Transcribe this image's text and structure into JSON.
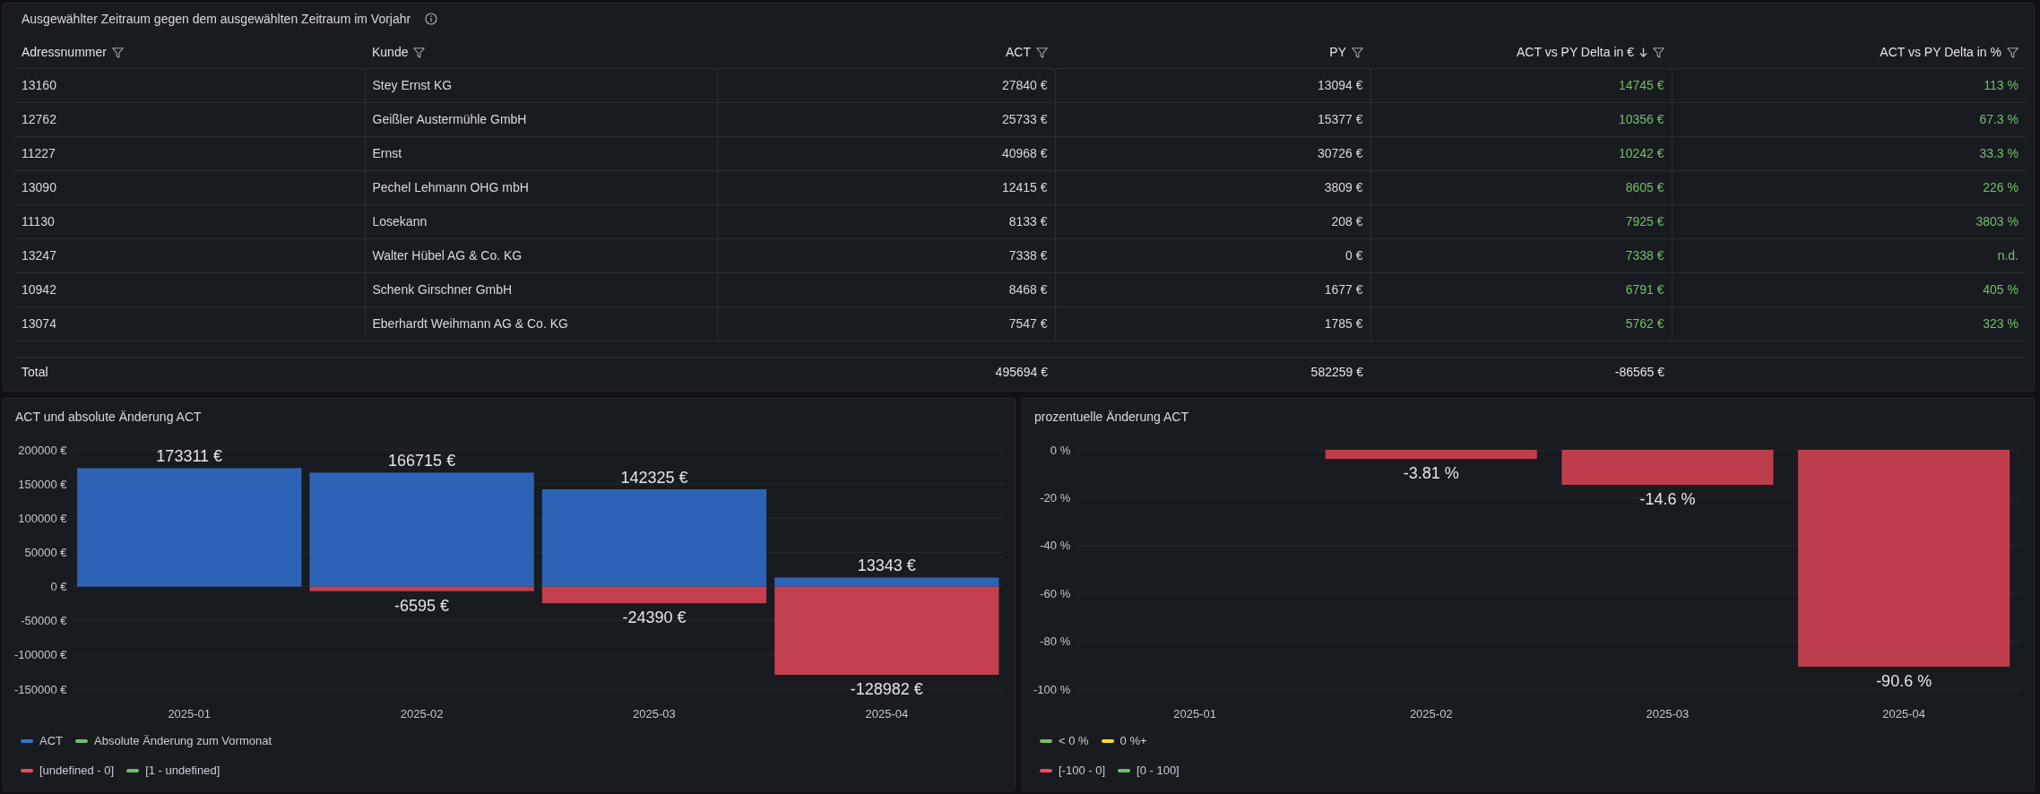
{
  "table_panel": {
    "title": "Ausgewählter Zeitraum gegen dem ausgewählten Zeitraum im Vorjahr",
    "columns": [
      {
        "label": "Adressnummer",
        "kind": "text",
        "sorted": false
      },
      {
        "label": "Kunde",
        "kind": "text",
        "sorted": false
      },
      {
        "label": "ACT",
        "kind": "number",
        "sorted": false
      },
      {
        "label": "PY",
        "kind": "number",
        "sorted": false
      },
      {
        "label": "ACT vs PY Delta in €",
        "kind": "delta",
        "sorted": true
      },
      {
        "label": "ACT vs PY Delta in %",
        "kind": "delta",
        "sorted": false
      }
    ],
    "rows": [
      {
        "cells": [
          "13160",
          "Stey Ernst KG",
          "27840 €",
          "13094 €",
          "14745 €",
          "113 %"
        ]
      },
      {
        "cells": [
          "12762",
          "Geißler Austermühle GmbH",
          "25733 €",
          "15377 €",
          "10356 €",
          "67.3 %"
        ]
      },
      {
        "cells": [
          "11227",
          "Ernst",
          "40968 €",
          "30726 €",
          "10242 €",
          "33.3 %"
        ]
      },
      {
        "cells": [
          "13090",
          "Pechel Lehmann OHG mbH",
          "12415 €",
          "3809 €",
          "8605 €",
          "226 %"
        ]
      },
      {
        "cells": [
          "11130",
          "Losekann",
          "8133 €",
          "208 €",
          "7925 €",
          "3803 %"
        ]
      },
      {
        "cells": [
          "13247",
          "Walter Hübel AG & Co. KG",
          "7338 €",
          "0 €",
          "7338 €",
          "n.d."
        ]
      },
      {
        "cells": [
          "10942",
          "Schenk Girschner GmbH",
          "8468 €",
          "1677 €",
          "6791 €",
          "405 %"
        ]
      },
      {
        "cells": [
          "13074",
          "Eberhardt Weihmann AG & Co. KG",
          "7547 €",
          "1785 €",
          "5762 €",
          "323 %"
        ]
      }
    ],
    "total": {
      "label": "Total",
      "act": "495694 €",
      "py": "582259 €",
      "delta": "-86565 €"
    }
  },
  "chart_panels": [
    {
      "title": "ACT und absolute Änderung ACT",
      "chart_data": {
        "type": "bar",
        "categories": [
          "2025-01",
          "2025-02",
          "2025-03",
          "2025-04"
        ],
        "series": [
          {
            "color": "#2d63b6",
            "values": [
              173311,
              166715,
              142325,
              13343
            ]
          },
          {
            "color": "#c4404f",
            "values": [
              null,
              -6595,
              -24390,
              -128982
            ]
          }
        ],
        "stacked": true,
        "grid": true,
        "ylim": [
          -150000,
          200000
        ],
        "yticks": [
          {
            "value": 200000,
            "label": "200000 €"
          },
          {
            "value": 150000,
            "label": "150000 €"
          },
          {
            "value": 100000,
            "label": "100000 €"
          },
          {
            "value": 50000,
            "label": "50000 €"
          },
          {
            "value": 0,
            "label": "0 €"
          },
          {
            "value": -50000,
            "label": "-50000 €"
          },
          {
            "value": -100000,
            "label": "-100000 €"
          },
          {
            "value": -150000,
            "label": "-150000 €"
          }
        ],
        "value_labels": [
          [
            "173311 €",
            "166715 €",
            "142325 €",
            "13343 €"
          ],
          [
            null,
            "-6595 €",
            "-24390 €",
            "-128982 €"
          ]
        ]
      },
      "legend": [
        [
          {
            "label": "ACT",
            "color": "#3274d9"
          },
          {
            "label": "Absolute Änderung zum Vormonat",
            "color": "#73bf69"
          }
        ],
        [
          {
            "label": "[undefined - 0]",
            "color": "#f2495c"
          },
          {
            "label": "[1 - undefined]",
            "color": "#73bf69"
          }
        ]
      ]
    },
    {
      "title": "prozentuelle Änderung ACT",
      "chart_data": {
        "type": "bar",
        "categories": [
          "2025-01",
          "2025-02",
          "2025-03",
          "2025-04"
        ],
        "series": [
          {
            "color": "#bf3e4d",
            "values": [
              null,
              -3.81,
              -14.6,
              -90.6
            ]
          }
        ],
        "grid": true,
        "ylim": [
          -100,
          0
        ],
        "yticks": [
          {
            "value": 0,
            "label": "0 %"
          },
          {
            "value": -20,
            "label": "-20 %"
          },
          {
            "value": -40,
            "label": "-40 %"
          },
          {
            "value": -60,
            "label": "-60 %"
          },
          {
            "value": -80,
            "label": "-80 %"
          },
          {
            "value": -100,
            "label": "-100 %"
          }
        ],
        "value_labels": [
          [
            null,
            "-3.81 %",
            "-14.6 %",
            "-90.6 %"
          ]
        ]
      },
      "legend": [
        [
          {
            "label": "< 0 %",
            "color": "#73bf69"
          },
          {
            "label": "0 %+",
            "color": "#fade2a"
          }
        ],
        [
          {
            "label": "[-100 - 0]",
            "color": "#f2495c"
          },
          {
            "label": "[0 - 100]",
            "color": "#73bf69"
          }
        ]
      ]
    }
  ]
}
